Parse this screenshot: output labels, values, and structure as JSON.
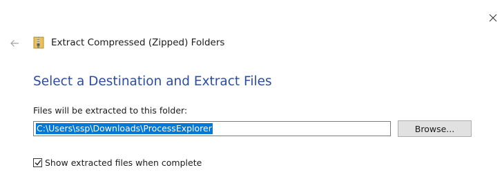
{
  "window": {
    "title": "Extract Compressed (Zipped) Folders",
    "close_icon": "close-icon",
    "back_icon": "back-arrow-icon",
    "folder_icon": "zip-folder-icon"
  },
  "page": {
    "heading": "Select a Destination and Extract Files",
    "field_label": "Files will be extracted to this folder:",
    "destination_value": "C:\\Users\\ssp\\Downloads\\ProcessExplorer",
    "browse_label": "Browse...",
    "show_files_label": "Show extracted files when complete",
    "show_files_checked": true
  },
  "colors": {
    "heading": "#2a4da1",
    "selection": "#0078d7",
    "button_bg": "#e1e1e1"
  }
}
